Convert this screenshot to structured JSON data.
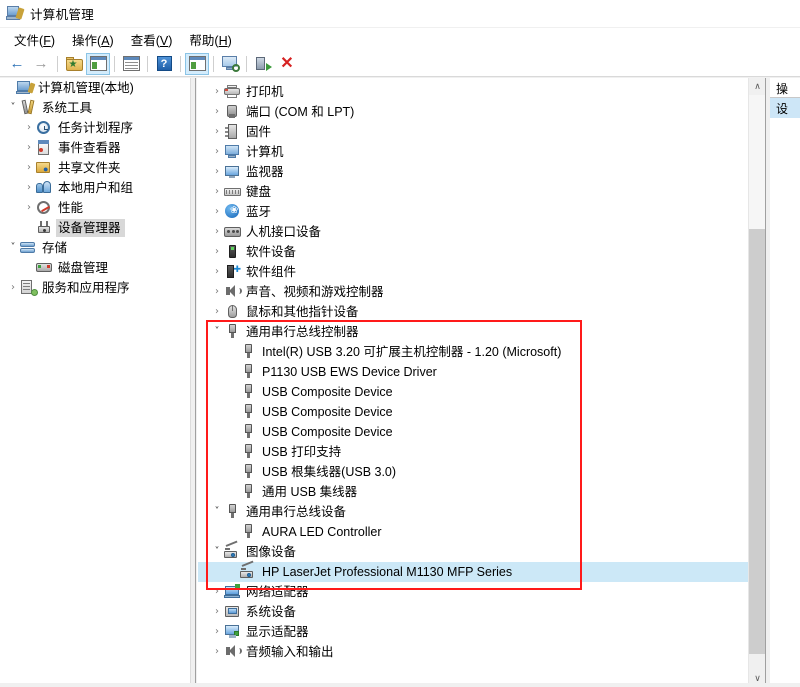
{
  "window": {
    "title": "计算机管理",
    "icon": "computer-management-icon"
  },
  "menu": {
    "items": [
      {
        "label": "文件(F)",
        "text": "文件",
        "mnemonic": "F"
      },
      {
        "label": "操作(A)",
        "text": "操作",
        "mnemonic": "A"
      },
      {
        "label": "查看(V)",
        "text": "查看",
        "mnemonic": "V"
      },
      {
        "label": "帮助(H)",
        "text": "帮助",
        "mnemonic": "H"
      }
    ]
  },
  "toolbar": {
    "buttons": [
      {
        "name": "back-arrow-icon",
        "glyph": "←",
        "pressed": false
      },
      {
        "name": "forward-arrow-icon",
        "glyph": "→",
        "pressed": false
      },
      {
        "name": "up-folder-icon",
        "pressed": false
      },
      {
        "name": "show-hide-console-tree-icon",
        "pressed": true
      },
      {
        "name": "properties-icon",
        "pressed": false
      },
      {
        "name": "help-icon",
        "glyph": "?",
        "pressed": false
      },
      {
        "name": "show-hide-action-pane-icon",
        "pressed": true
      },
      {
        "name": "scan-monitor-icon",
        "pressed": false
      },
      {
        "name": "update-driver-icon",
        "pressed": false
      },
      {
        "name": "uninstall-device-icon",
        "glyph": "✕",
        "pressed": false
      }
    ]
  },
  "sidebar": {
    "items": [
      {
        "label": "计算机管理(本地)",
        "icon": "computer-management-icon",
        "indent": 0,
        "chevron": "none",
        "selected": false
      },
      {
        "label": "系统工具",
        "icon": "system-tools-icon",
        "indent": 1,
        "chevron": "open",
        "selected": false
      },
      {
        "label": "任务计划程序",
        "icon": "task-scheduler-icon",
        "indent": 2,
        "chevron": "closed",
        "selected": false
      },
      {
        "label": "事件查看器",
        "icon": "event-viewer-icon",
        "indent": 2,
        "chevron": "closed",
        "selected": false
      },
      {
        "label": "共享文件夹",
        "icon": "shared-folders-icon",
        "indent": 2,
        "chevron": "closed",
        "selected": false
      },
      {
        "label": "本地用户和组",
        "icon": "local-users-groups-icon",
        "indent": 2,
        "chevron": "closed",
        "selected": false
      },
      {
        "label": "性能",
        "icon": "performance-icon",
        "indent": 2,
        "chevron": "closed",
        "selected": false
      },
      {
        "label": "设备管理器",
        "icon": "device-manager-icon",
        "indent": 2,
        "chevron": "none",
        "selected": true
      },
      {
        "label": "存储",
        "icon": "storage-icon",
        "indent": 1,
        "chevron": "open",
        "selected": false
      },
      {
        "label": "磁盘管理",
        "icon": "disk-management-icon",
        "indent": 2,
        "chevron": "none",
        "selected": false
      },
      {
        "label": "服务和应用程序",
        "icon": "services-applications-icon",
        "indent": 1,
        "chevron": "closed",
        "selected": false
      }
    ]
  },
  "device_tree": {
    "rows": [
      {
        "label": "打印机",
        "icon": "printer-icon",
        "level": 1,
        "chevron": "closed",
        "selected": false
      },
      {
        "label": "端口 (COM 和 LPT)",
        "icon": "port-icon",
        "level": 1,
        "chevron": "closed",
        "selected": false
      },
      {
        "label": "固件",
        "icon": "firmware-icon",
        "level": 1,
        "chevron": "closed",
        "selected": false
      },
      {
        "label": "计算机",
        "icon": "computer-icon",
        "level": 1,
        "chevron": "closed",
        "selected": false
      },
      {
        "label": "监视器",
        "icon": "monitor-icon",
        "level": 1,
        "chevron": "closed",
        "selected": false
      },
      {
        "label": "键盘",
        "icon": "keyboard-icon",
        "level": 1,
        "chevron": "closed",
        "selected": false
      },
      {
        "label": "蓝牙",
        "icon": "bluetooth-icon",
        "level": 1,
        "chevron": "closed",
        "selected": false
      },
      {
        "label": "人机接口设备",
        "icon": "hid-icon",
        "level": 1,
        "chevron": "closed",
        "selected": false
      },
      {
        "label": "软件设备",
        "icon": "software-device-icon",
        "level": 1,
        "chevron": "closed",
        "selected": false
      },
      {
        "label": "软件组件",
        "icon": "software-component-icon",
        "level": 1,
        "chevron": "closed",
        "selected": false
      },
      {
        "label": "声音、视频和游戏控制器",
        "icon": "sound-video-game-icon",
        "level": 1,
        "chevron": "closed",
        "selected": false
      },
      {
        "label": "鼠标和其他指针设备",
        "icon": "mouse-icon",
        "level": 1,
        "chevron": "closed",
        "selected": false
      },
      {
        "label": "通用串行总线控制器",
        "icon": "usb-icon",
        "level": 1,
        "chevron": "open",
        "selected": false
      },
      {
        "label": "Intel(R) USB 3.20 可扩展主机控制器 - 1.20 (Microsoft)",
        "icon": "usb-icon",
        "level": 2,
        "chevron": "none",
        "selected": false
      },
      {
        "label": "P1130 USB EWS Device Driver",
        "icon": "usb-icon",
        "level": 2,
        "chevron": "none",
        "selected": false
      },
      {
        "label": "USB Composite Device",
        "icon": "usb-icon",
        "level": 2,
        "chevron": "none",
        "selected": false
      },
      {
        "label": "USB Composite Device",
        "icon": "usb-icon",
        "level": 2,
        "chevron": "none",
        "selected": false
      },
      {
        "label": "USB Composite Device",
        "icon": "usb-icon",
        "level": 2,
        "chevron": "none",
        "selected": false
      },
      {
        "label": "USB 打印支持",
        "icon": "usb-icon",
        "level": 2,
        "chevron": "none",
        "selected": false
      },
      {
        "label": "USB 根集线器(USB 3.0)",
        "icon": "usb-icon",
        "level": 2,
        "chevron": "none",
        "selected": false
      },
      {
        "label": "通用 USB 集线器",
        "icon": "usb-icon",
        "level": 2,
        "chevron": "none",
        "selected": false
      },
      {
        "label": "通用串行总线设备",
        "icon": "usb-icon",
        "level": 1,
        "chevron": "open",
        "selected": false
      },
      {
        "label": "AURA LED Controller",
        "icon": "usb-icon",
        "level": 2,
        "chevron": "none",
        "selected": false
      },
      {
        "label": "图像设备",
        "icon": "imaging-device-icon",
        "level": 1,
        "chevron": "open",
        "selected": false
      },
      {
        "label": "HP LaserJet Professional M1130 MFP Series",
        "icon": "imaging-device-icon",
        "level": 2,
        "chevron": "none",
        "selected": true
      },
      {
        "label": "网络适配器",
        "icon": "network-adapter-icon",
        "level": 1,
        "chevron": "closed",
        "selected": false
      },
      {
        "label": "系统设备",
        "icon": "system-device-icon",
        "level": 1,
        "chevron": "closed",
        "selected": false
      },
      {
        "label": "显示适配器",
        "icon": "display-adapter-icon",
        "level": 1,
        "chevron": "closed",
        "selected": false
      },
      {
        "label": "音频输入和输出",
        "icon": "audio-io-icon",
        "level": 1,
        "chevron": "closed",
        "selected": false
      }
    ]
  },
  "annotation": {
    "highlight_color": "#ff1a1a",
    "name": "red-highlight-box"
  },
  "action_pane": {
    "header": "操",
    "item": "设"
  },
  "scrollbar": {
    "up_glyph": "∧",
    "down_glyph": "∨"
  },
  "colors": {
    "selection_blue": "#cce8f7",
    "selection_gray": "#d8d8d8",
    "toolbar_pressed": "#d3ecfc",
    "annotation_red": "#ff1a1a"
  }
}
